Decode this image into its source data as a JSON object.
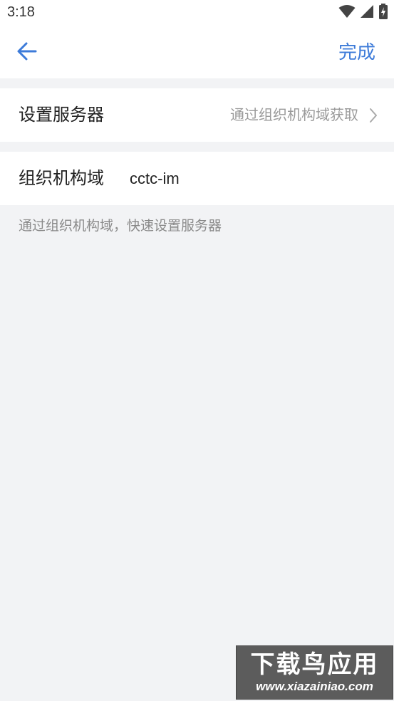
{
  "status_bar": {
    "time": "3:18",
    "icons": [
      "wifi-icon",
      "signal-icon",
      "battery-icon"
    ]
  },
  "app_bar": {
    "back_icon": "arrow-left-icon",
    "done_label": "完成",
    "accent_color": "#3d7bd9"
  },
  "server_row": {
    "label": "设置服务器",
    "value": "通过组织机构域获取",
    "chevron_icon": "chevron-right-icon"
  },
  "domain_row": {
    "label": "组织机构域",
    "value": "cctc-im"
  },
  "hint": "通过组织机构域，快速设置服务器",
  "watermark": {
    "title": "下载鸟应用",
    "url": "www.xiazainiao.com"
  }
}
